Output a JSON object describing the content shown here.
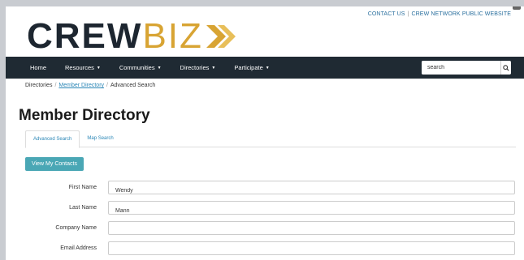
{
  "header": {
    "top_links": [
      "CONTACT US",
      "CREW NETWORK PUBLIC WEBSITE"
    ],
    "logo": {
      "part1": "CREW",
      "part2": "BIZ",
      "accent_color": "#d8a433",
      "dark_color": "#1d2630"
    }
  },
  "nav": {
    "items": [
      {
        "label": "Home",
        "dropdown": false
      },
      {
        "label": "Resources",
        "dropdown": true
      },
      {
        "label": "Communities",
        "dropdown": true
      },
      {
        "label": "Directories",
        "dropdown": true
      },
      {
        "label": "Participate",
        "dropdown": true
      }
    ],
    "search_value": "search",
    "search_icon": "search-icon"
  },
  "breadcrumb": [
    "Directories",
    "Member Directory",
    "Advanced Search"
  ],
  "page_title": "Member Directory",
  "tabs": [
    "Advanced Search",
    "Map Search"
  ],
  "view_contacts_label": "View My Contacts",
  "form": [
    {
      "label": "First Name",
      "value": "Wendy"
    },
    {
      "label": "Last Name",
      "value": "Mann"
    },
    {
      "label": "Company Name",
      "value": ""
    },
    {
      "label": "Email Address",
      "value": ""
    }
  ],
  "colors": {
    "navbar": "#1f2a33",
    "button": "#4aa7b5",
    "link": "#2a86b6"
  }
}
